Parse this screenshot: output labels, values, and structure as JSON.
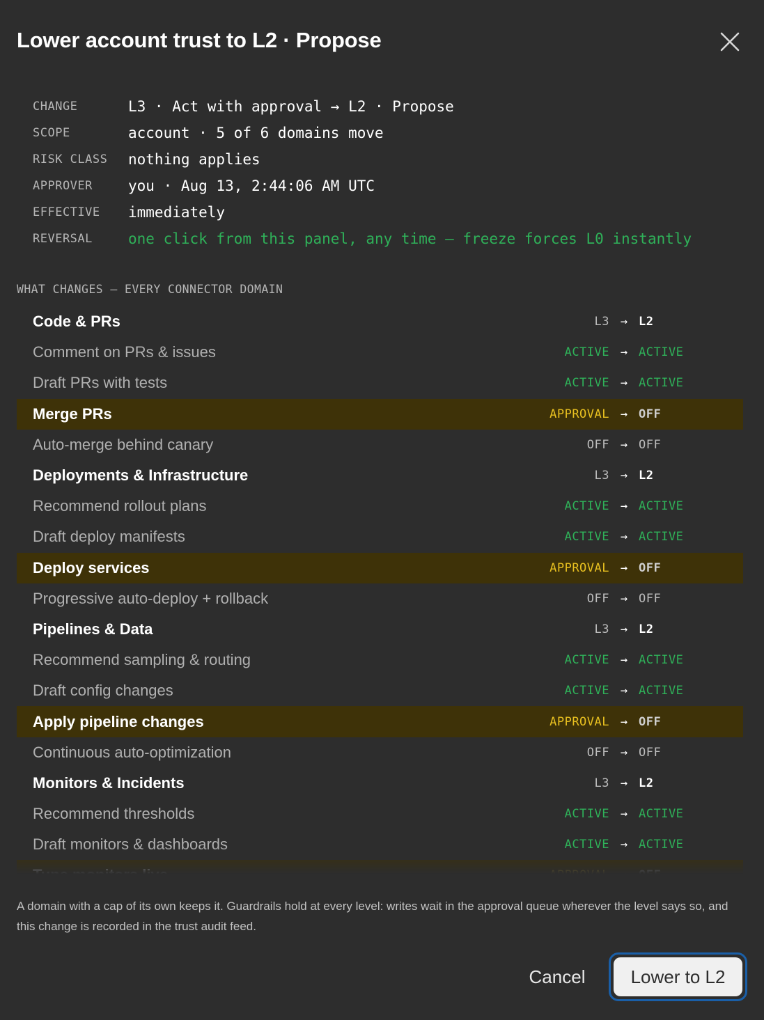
{
  "dialog": {
    "title": "Lower account trust to L2 · Propose",
    "close_icon": "close-icon"
  },
  "meta": [
    {
      "key": "CHANGE",
      "value": "L3 · Act with approval → L2 · Propose",
      "tone": "normal"
    },
    {
      "key": "SCOPE",
      "value": "account · 5 of 6 domains move",
      "tone": "normal"
    },
    {
      "key": "RISK CLASS",
      "value": "nothing applies",
      "tone": "normal"
    },
    {
      "key": "APPROVER",
      "value": "you · Aug 13, 2:44:06 AM UTC",
      "tone": "normal"
    },
    {
      "key": "EFFECTIVE",
      "value": "immediately",
      "tone": "normal"
    },
    {
      "key": "REVERSAL",
      "value": "one click from this panel, any time — freeze forces L0 instantly",
      "tone": "green"
    }
  ],
  "section_label": "WHAT CHANGES — EVERY CONNECTOR DOMAIN",
  "arrow": "→",
  "rows": [
    {
      "label": "Code & PRs",
      "kind": "domain",
      "from": "L3",
      "to": "L2"
    },
    {
      "label": "Comment on PRs & issues",
      "kind": "item",
      "from": "ACTIVE",
      "to": "ACTIVE"
    },
    {
      "label": "Draft PRs with tests",
      "kind": "item",
      "from": "ACTIVE",
      "to": "ACTIVE"
    },
    {
      "label": "Merge PRs",
      "kind": "highlight",
      "from": "APPROVAL",
      "to": "OFF"
    },
    {
      "label": "Auto-merge behind canary",
      "kind": "item",
      "from": "OFF",
      "to": "OFF"
    },
    {
      "label": "Deployments & Infrastructure",
      "kind": "domain",
      "from": "L3",
      "to": "L2"
    },
    {
      "label": "Recommend rollout plans",
      "kind": "item",
      "from": "ACTIVE",
      "to": "ACTIVE"
    },
    {
      "label": "Draft deploy manifests",
      "kind": "item",
      "from": "ACTIVE",
      "to": "ACTIVE"
    },
    {
      "label": "Deploy services",
      "kind": "highlight",
      "from": "APPROVAL",
      "to": "OFF"
    },
    {
      "label": "Progressive auto-deploy + rollback",
      "kind": "item",
      "from": "OFF",
      "to": "OFF"
    },
    {
      "label": "Pipelines & Data",
      "kind": "domain",
      "from": "L3",
      "to": "L2"
    },
    {
      "label": "Recommend sampling & routing",
      "kind": "item",
      "from": "ACTIVE",
      "to": "ACTIVE"
    },
    {
      "label": "Draft config changes",
      "kind": "item",
      "from": "ACTIVE",
      "to": "ACTIVE"
    },
    {
      "label": "Apply pipeline changes",
      "kind": "highlight",
      "from": "APPROVAL",
      "to": "OFF"
    },
    {
      "label": "Continuous auto-optimization",
      "kind": "item",
      "from": "OFF",
      "to": "OFF"
    },
    {
      "label": "Monitors & Incidents",
      "kind": "domain",
      "from": "L3",
      "to": "L2"
    },
    {
      "label": "Recommend thresholds",
      "kind": "item",
      "from": "ACTIVE",
      "to": "ACTIVE"
    },
    {
      "label": "Draft monitors & dashboards",
      "kind": "item",
      "from": "ACTIVE",
      "to": "ACTIVE"
    },
    {
      "label": "Tune monitors live",
      "kind": "highlight",
      "from": "APPROVAL",
      "to": "OFF"
    }
  ],
  "footer_note": "A domain with a cap of its own keeps it. Guardrails hold at every level: writes wait in the approval queue wherever the level says so, and this change is recorded in the trust audit feed.",
  "buttons": {
    "cancel": "Cancel",
    "confirm": "Lower to L2"
  },
  "colors": {
    "background": "#2d2d2d",
    "active": "#2fb159",
    "approval": "#e8c020",
    "highlight_row": "#3e3208",
    "focus_ring": "#1a5fa8"
  }
}
